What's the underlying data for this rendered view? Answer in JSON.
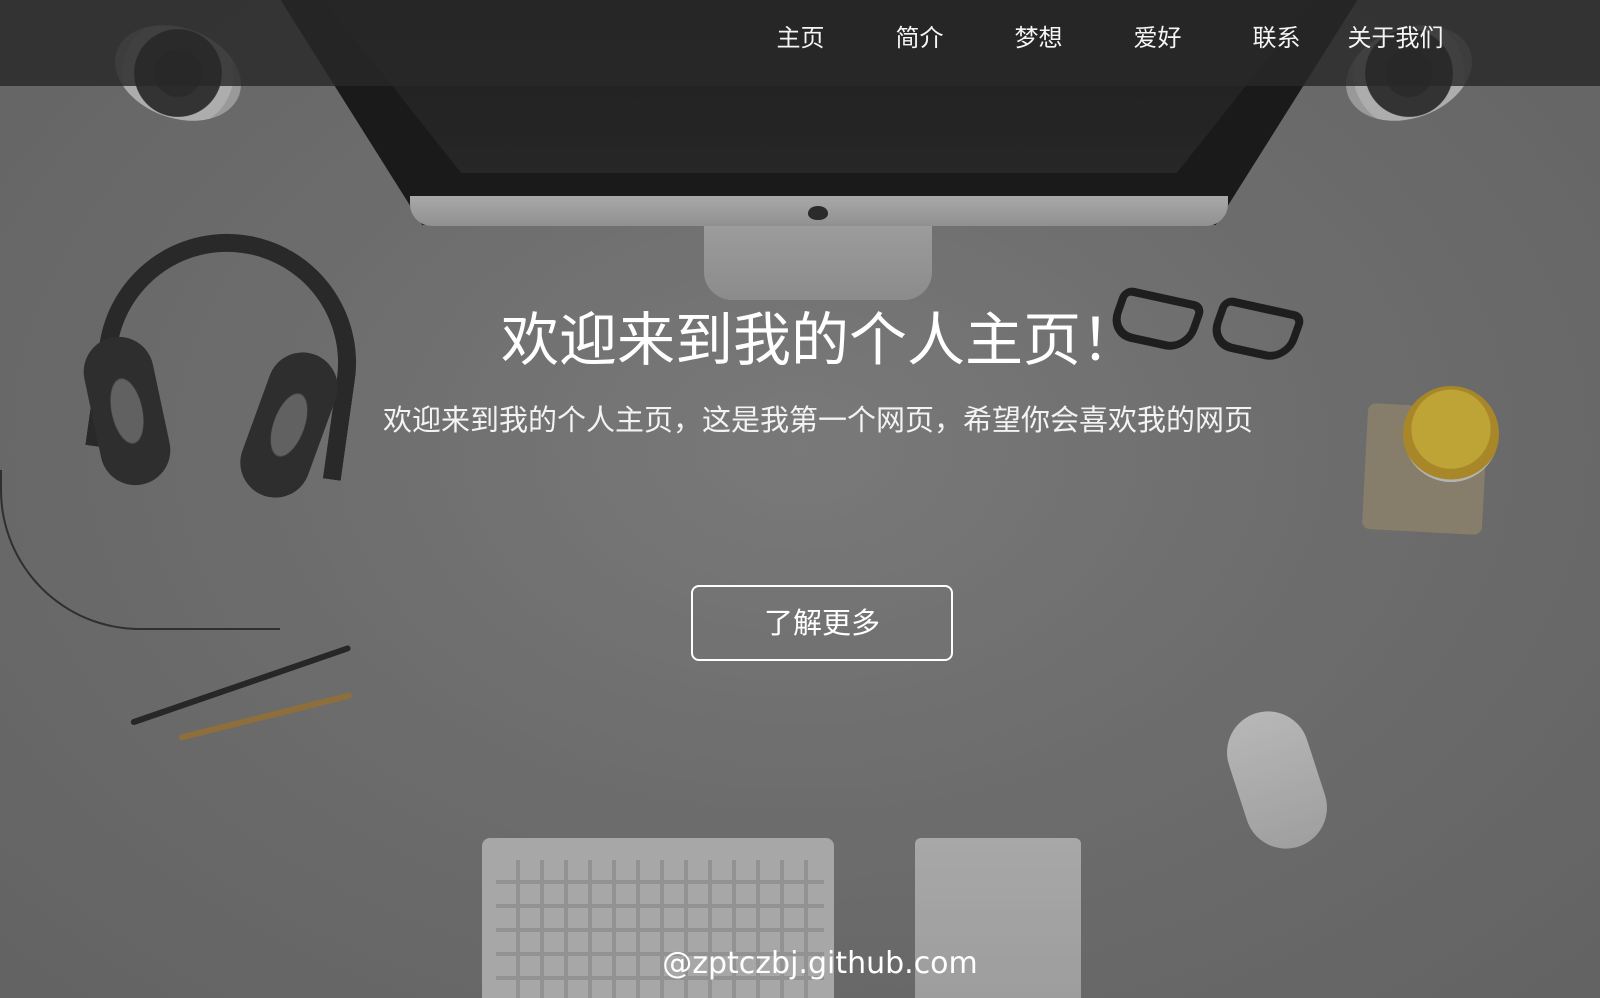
{
  "nav": {
    "items": [
      {
        "label": "主页"
      },
      {
        "label": "简介"
      },
      {
        "label": "梦想"
      },
      {
        "label": "爱好"
      },
      {
        "label": "联系"
      },
      {
        "label": "关于我们"
      }
    ]
  },
  "hero": {
    "title": "欢迎来到我的个人主页！",
    "subtitle": "欢迎来到我的个人主页，这是我第一个网页，希望你会喜欢我的网页",
    "cta_label": "了解更多"
  },
  "footer": {
    "text": "@zptczbj.github.com"
  },
  "colors": {
    "navbar_bg": "#282828",
    "text_primary": "#ffffff",
    "page_bg": "#7b7b7b"
  }
}
